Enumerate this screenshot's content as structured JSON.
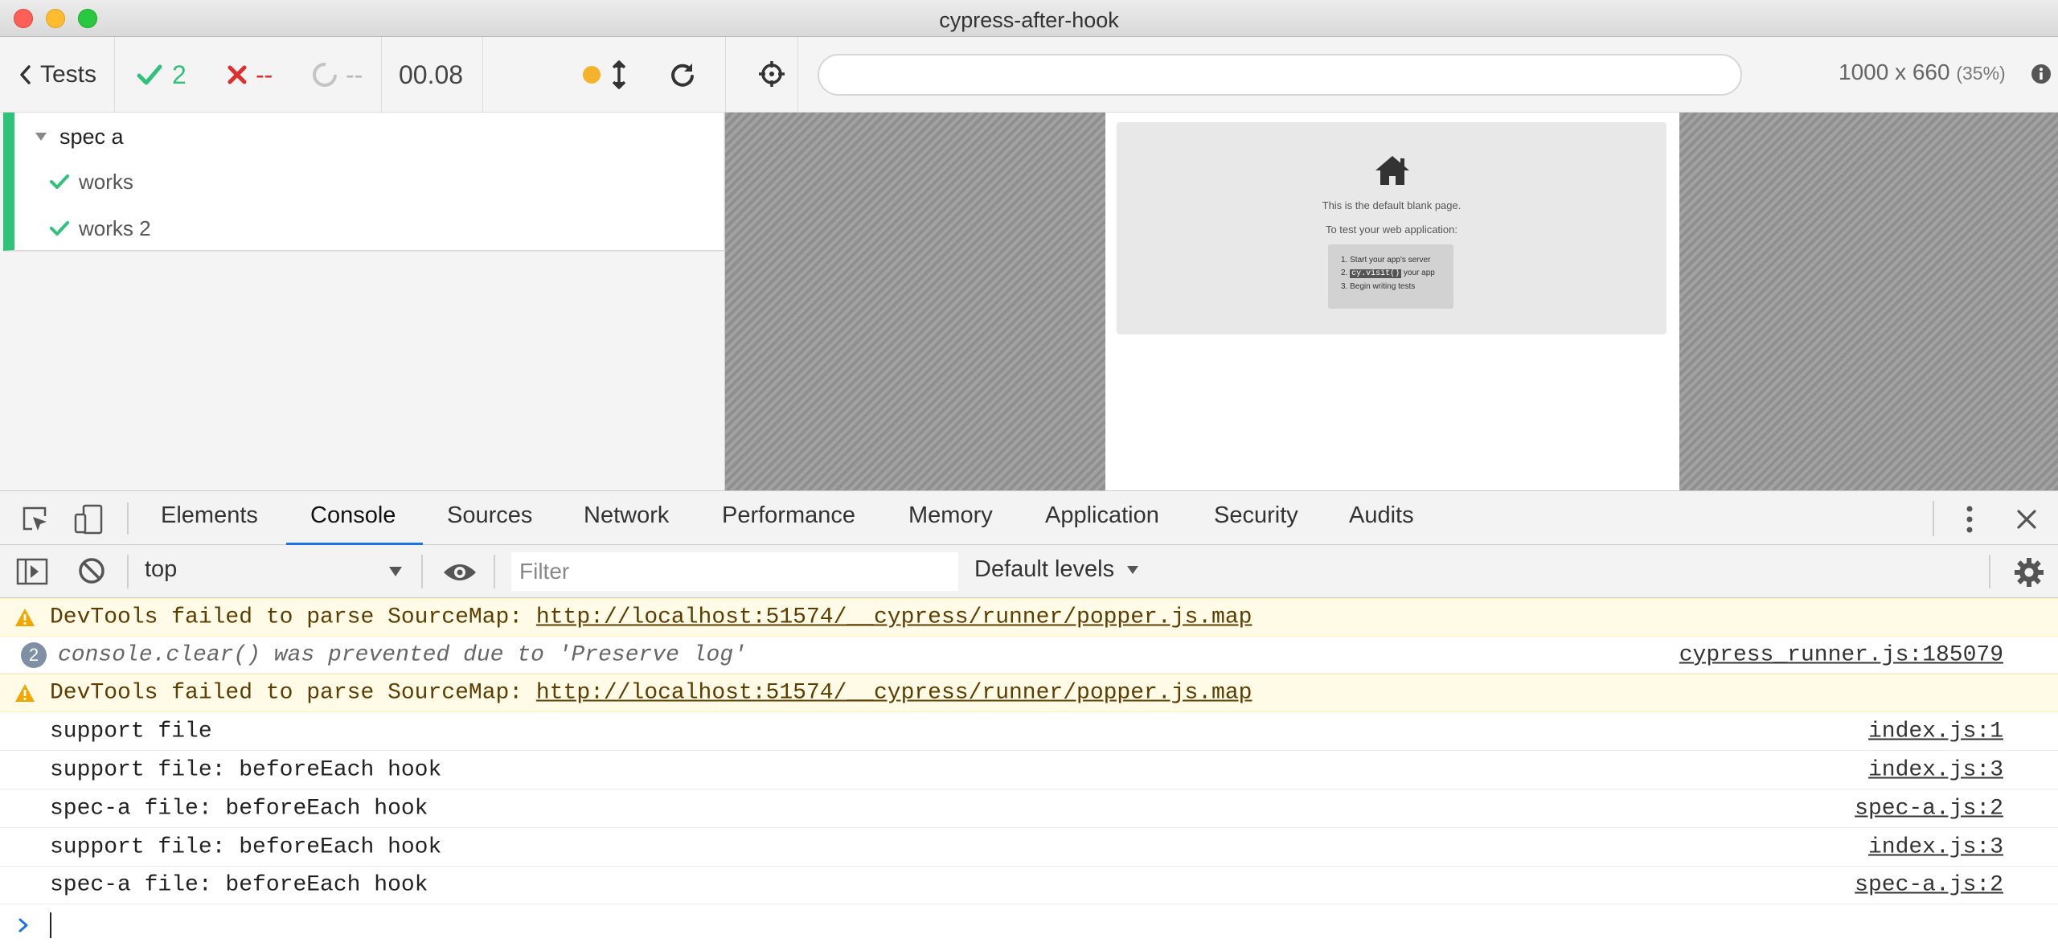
{
  "window": {
    "title": "cypress-after-hook",
    "colors": {
      "close": "#fe5f57",
      "minimize": "#febc2e",
      "maximize": "#28c840"
    }
  },
  "reporter": {
    "back_label": "Tests",
    "passed_count": "2",
    "failed_count": "--",
    "pending_count": "--",
    "duration": "00.08",
    "suite": {
      "title": "spec a",
      "tests": [
        {
          "title": "works",
          "state": "passed"
        },
        {
          "title": "works 2",
          "state": "passed"
        }
      ]
    },
    "colors": {
      "passed": "#2fc27b",
      "failed": "#e02d2d",
      "running_dot": "#f5b32d"
    }
  },
  "aut": {
    "url": "",
    "viewport_size": "1000 x 660",
    "viewport_scale": "(35%)",
    "blank_page": {
      "line1": "This is the default blank page.",
      "line2": "To test your web application:",
      "steps": [
        {
          "num": "1.",
          "text": "Start your app's server"
        },
        {
          "num": "2.",
          "code": "cy.visit()",
          "text": "your app"
        },
        {
          "num": "3.",
          "text": "Begin writing tests"
        }
      ]
    }
  },
  "devtools": {
    "tabs": [
      "Elements",
      "Console",
      "Sources",
      "Network",
      "Performance",
      "Memory",
      "Application",
      "Security",
      "Audits"
    ],
    "active_tab": "Console",
    "console": {
      "context": "top",
      "filter_placeholder": "Filter",
      "levels_label": "Default levels",
      "messages": [
        {
          "type": "warning",
          "text": "DevTools failed to parse SourceMap: ",
          "link": "http://localhost:51574/__cypress/runner/popper.js.map",
          "source": ""
        },
        {
          "type": "info",
          "repeat": "2",
          "text": "console.clear() was prevented due to 'Preserve log'",
          "source": "cypress_runner.js:185079"
        },
        {
          "type": "warning",
          "text": "DevTools failed to parse SourceMap: ",
          "link": "http://localhost:51574/__cypress/runner/popper.js.map",
          "source": ""
        },
        {
          "type": "log",
          "text": "support file",
          "source": "index.js:1"
        },
        {
          "type": "log",
          "text": "support file: beforeEach hook",
          "source": "index.js:3"
        },
        {
          "type": "log",
          "text": "spec-a file: beforeEach hook",
          "source": "spec-a.js:2"
        },
        {
          "type": "log",
          "text": "support file: beforeEach hook",
          "source": "index.js:3"
        },
        {
          "type": "log",
          "text": "spec-a file: beforeEach hook",
          "source": "spec-a.js:2"
        }
      ]
    },
    "colors": {
      "active_tab_underline": "#1a73e8",
      "warning_bg": "#fffbe6",
      "prompt": "#1a73e8"
    }
  }
}
